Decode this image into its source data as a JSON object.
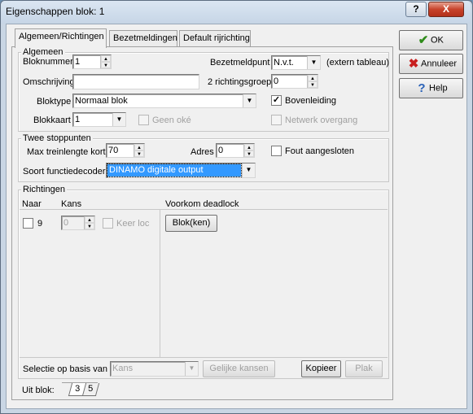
{
  "window": {
    "title": "Eigenschappen blok: 1",
    "help_button": "?",
    "close_button": "X"
  },
  "tabs": [
    {
      "label": "Algemeen/Richtingen"
    },
    {
      "label": "Bezetmeldingen"
    },
    {
      "label": "Default rijrichting"
    }
  ],
  "side_buttons": {
    "ok": {
      "label": "OK",
      "icon": "check-icon"
    },
    "cancel": {
      "label": "Annuleer",
      "icon": "x-icon"
    },
    "help": {
      "label": "Help",
      "icon": "question-icon"
    }
  },
  "algemeen": {
    "title": "Algemeen",
    "bloknummer_label": "Bloknummer",
    "bloknummer_value": "1",
    "bezetmeldpunt_label": "Bezetmeldpunt",
    "bezetmeldpunt_value": "N.v.t.",
    "extern_tableau": "(extern tableau)",
    "omschrijving_label": "Omschrijving",
    "omschrijving_value": "",
    "richtingsgroep_label": "2 richtingsgroep",
    "richtingsgroep_value": "0",
    "bloktype_label": "Bloktype",
    "bloktype_value": "Normaal blok",
    "bovenleiding_label": "Bovenleiding",
    "bovenleiding_checked": "✓",
    "blokkaart_label": "Blokkaart",
    "blokkaart_value": "1",
    "geen_oke_label": "Geen oké",
    "netwerk_overgang_label": "Netwerk overgang"
  },
  "stoppunten": {
    "title": "Twee stoppunten",
    "max_label": "Max treinlengte kort",
    "max_value": "70",
    "adres_label": "Adres",
    "adres_value": "0",
    "fout_label": "Fout aangesloten",
    "soort_label": "Soort functiedecoder",
    "soort_value": "DINAMO digitale output"
  },
  "richtingen": {
    "title": "Richtingen",
    "columns": {
      "naar": "Naar",
      "kans": "Kans",
      "deadlock": "Voorkom deadlock"
    },
    "row": {
      "naar": "9",
      "kans": "0",
      "keer_loc": "Keer loc",
      "blok_button": "Blok(ken)"
    },
    "selectie_label": "Selectie op basis van",
    "selectie_value": "Kans",
    "gelijke_kansen": "Gelijke kansen",
    "kopieer": "Kopieer",
    "plak": "Plak"
  },
  "uit_blok": {
    "label": "Uit blok:",
    "tabs": [
      "3",
      "5"
    ]
  },
  "colors": {
    "selection": "#3399ff",
    "close_button": "#c7432b"
  }
}
